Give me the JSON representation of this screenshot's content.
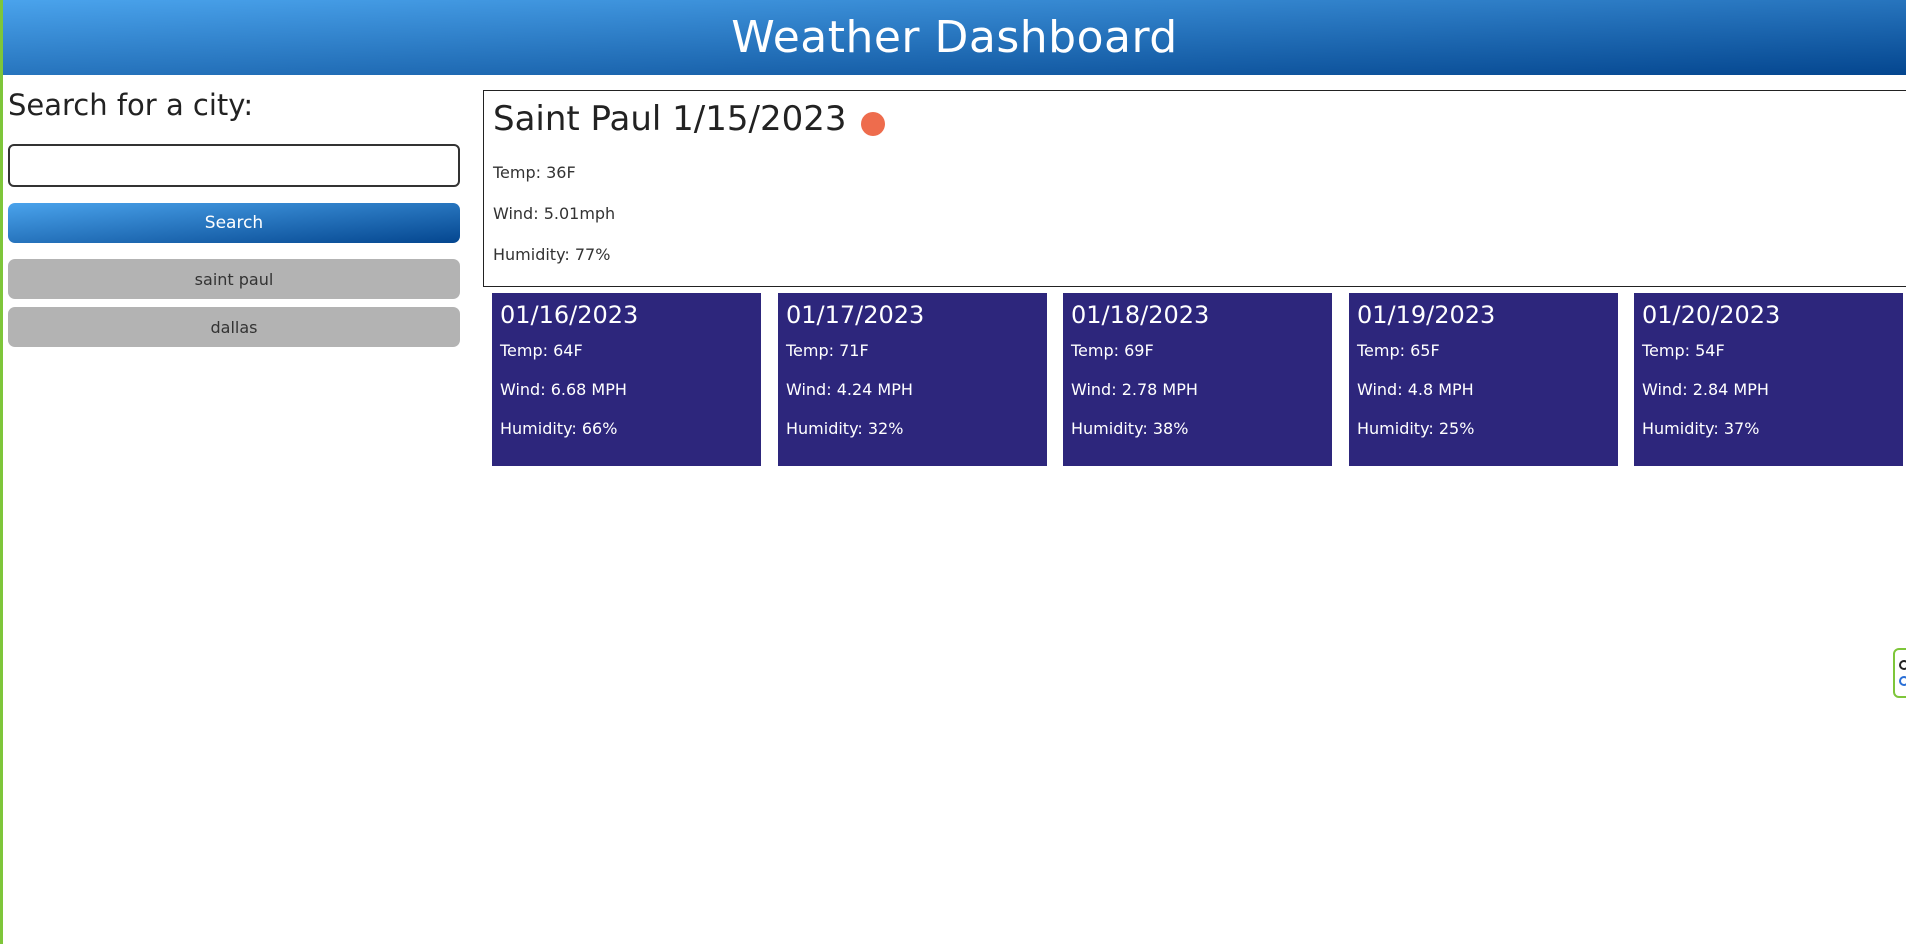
{
  "header": {
    "title": "Weather Dashboard"
  },
  "sidebar": {
    "heading": "Search for a city:",
    "search_value": "",
    "search_button": "Search",
    "history": [
      "saint paul",
      "dallas"
    ]
  },
  "current": {
    "title": "Saint Paul 1/15/2023",
    "icon": "weather-icon",
    "temp": "Temp: 36F",
    "wind": "Wind: 5.01mph",
    "humidity": "Humidity: 77%"
  },
  "forecast": [
    {
      "date": "01/16/2023",
      "temp": "Temp: 64F",
      "wind": "Wind: 6.68 MPH",
      "humidity": "Humidity: 66%"
    },
    {
      "date": "01/17/2023",
      "temp": "Temp: 71F",
      "wind": "Wind: 4.24 MPH",
      "humidity": "Humidity: 32%"
    },
    {
      "date": "01/18/2023",
      "temp": "Temp: 69F",
      "wind": "Wind: 2.78 MPH",
      "humidity": "Humidity: 38%"
    },
    {
      "date": "01/19/2023",
      "temp": "Temp: 65F",
      "wind": "Wind: 4.8 MPH",
      "humidity": "Humidity: 25%"
    },
    {
      "date": "01/20/2023",
      "temp": "Temp: 54F",
      "wind": "Wind: 2.84 MPH",
      "humidity": "Humidity: 37%"
    }
  ],
  "colors": {
    "header_gradient_start": "#4aa3ec",
    "header_gradient_end": "#04468f",
    "forecast_card": "#2d267c",
    "history_button": "#b3b3b3",
    "weather_icon": "#ee6c4d"
  }
}
